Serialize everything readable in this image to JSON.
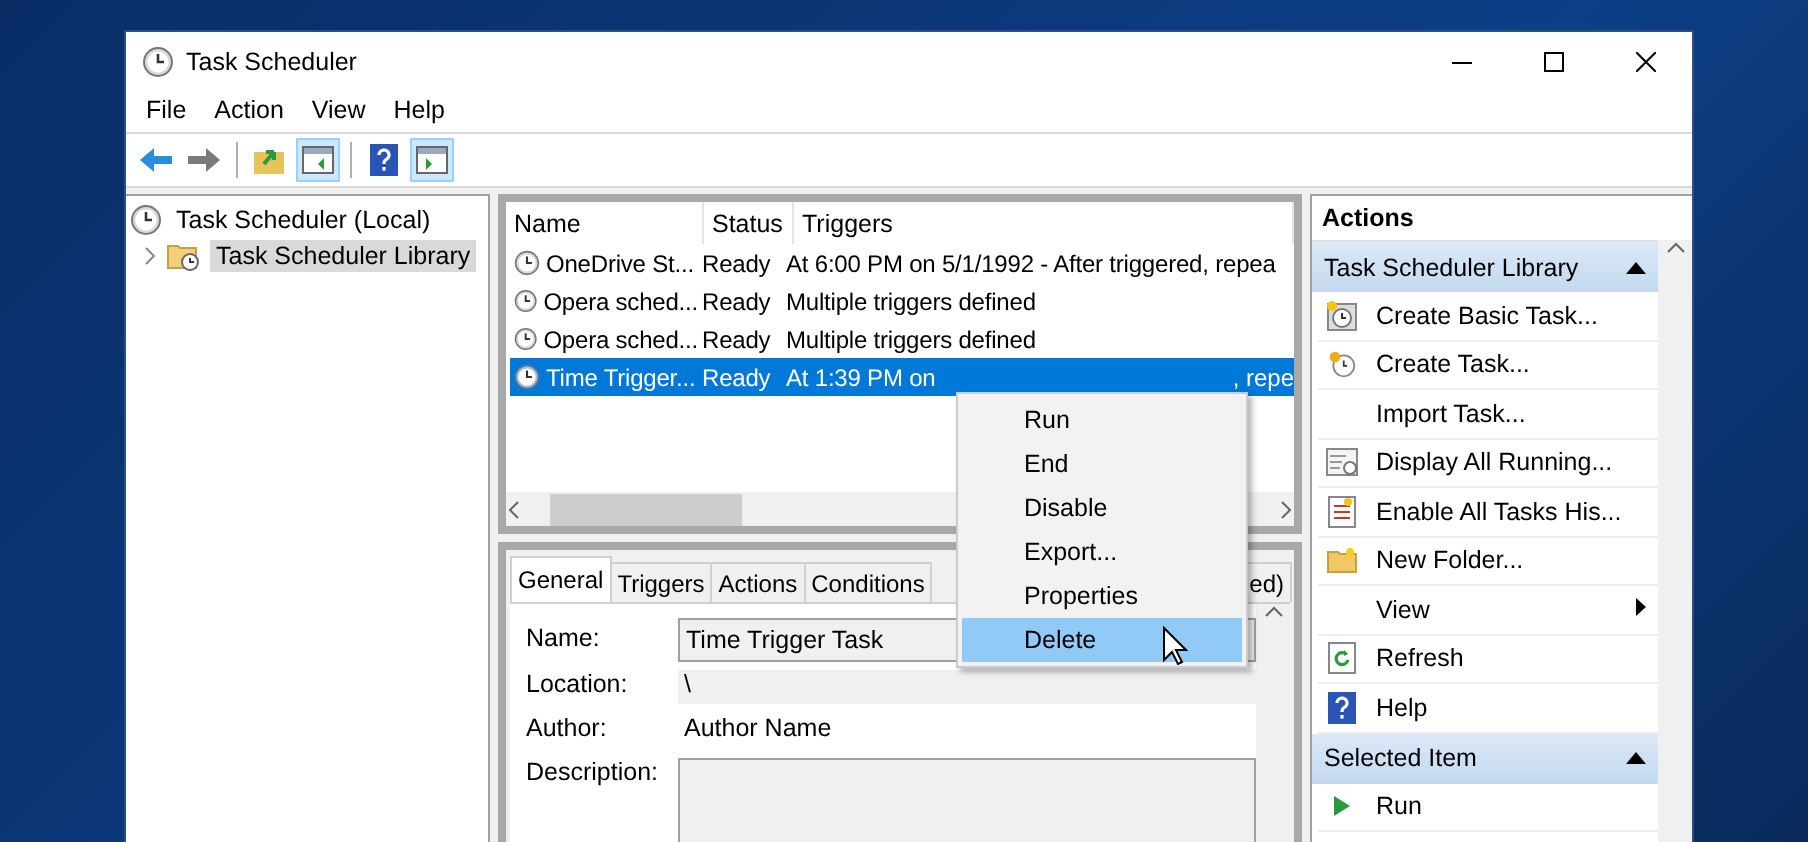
{
  "window": {
    "title": "Task Scheduler"
  },
  "menu": [
    "File",
    "Action",
    "View",
    "Help"
  ],
  "toolbar": [
    {
      "kind": "back",
      "pressed": false
    },
    {
      "kind": "forward",
      "pressed": false
    },
    {
      "kind": "up",
      "pressed": false
    },
    {
      "kind": "tree-pane",
      "pressed": true
    },
    {
      "kind": "help",
      "pressed": false
    },
    {
      "kind": "action-pane",
      "pressed": true
    }
  ],
  "tree": [
    {
      "label": "Task Scheduler (Local)",
      "selected": false,
      "children": [
        {
          "label": "Task Scheduler Library",
          "selected": true
        }
      ]
    }
  ],
  "task_list": {
    "columns": [
      "Name",
      "Status",
      "Triggers"
    ],
    "rows": [
      {
        "name": "OneDrive St...",
        "status": "Ready",
        "trigger": "At 6:00 PM on 5/1/1992 - After triggered, repea",
        "selected": false
      },
      {
        "name": "Opera sched...",
        "status": "Ready",
        "trigger": "Multiple triggers defined",
        "selected": false
      },
      {
        "name": "Opera sched...",
        "status": "Ready",
        "trigger": "Multiple triggers defined",
        "selected": false
      },
      {
        "name": "Time Trigger...",
        "status": "Ready",
        "trigger": "At 1:39 PM on",
        "trigger_tail": ", repe",
        "selected": true
      }
    ]
  },
  "context_menu": [
    {
      "label": "Run",
      "selected": false
    },
    {
      "label": "End",
      "selected": false
    },
    {
      "label": "Disable",
      "selected": false
    },
    {
      "label": "Export...",
      "selected": false
    },
    {
      "label": "Properties",
      "selected": false
    },
    {
      "label": "Delete",
      "selected": true
    }
  ],
  "details": {
    "tabs": [
      {
        "label": "General",
        "selected": true
      },
      {
        "label": "Triggers",
        "selected": false
      },
      {
        "label": "Actions",
        "selected": false
      },
      {
        "label": "Conditions",
        "selected": false
      },
      {
        "label": "ed)",
        "selected": false
      }
    ],
    "fields": [
      {
        "label": "Name:",
        "value": "Time Trigger Task",
        "kind": "field"
      },
      {
        "label": "Location:",
        "value": "\\",
        "kind": "readonly"
      },
      {
        "label": "Author:",
        "value": "Author Name",
        "kind": "text"
      },
      {
        "label": "Description:",
        "kind": "area"
      }
    ]
  },
  "actions": {
    "title": "Actions",
    "sections": [
      {
        "title": "Task Scheduler Library",
        "expanded": true,
        "items": [
          {
            "label": "Create Basic Task...",
            "kind": "clock-star",
            "submenu": false
          },
          {
            "label": "Create Task...",
            "kind": "clock-small",
            "submenu": false
          },
          {
            "label": "Import Task...",
            "kind": "none",
            "submenu": false
          },
          {
            "label": "Display All Running...",
            "kind": "window-clock",
            "submenu": false
          },
          {
            "label": "Enable All Tasks His...",
            "kind": "list",
            "submenu": false
          },
          {
            "label": "New Folder...",
            "kind": "folder",
            "submenu": false
          },
          {
            "label": "View",
            "kind": "none",
            "submenu": true
          },
          {
            "label": "Refresh",
            "kind": "refresh",
            "submenu": false
          },
          {
            "label": "Help",
            "kind": "help",
            "submenu": false
          }
        ]
      },
      {
        "title": "Selected Item",
        "expanded": true,
        "items": [
          {
            "label": "Run",
            "kind": "play",
            "submenu": false
          }
        ]
      }
    ]
  }
}
